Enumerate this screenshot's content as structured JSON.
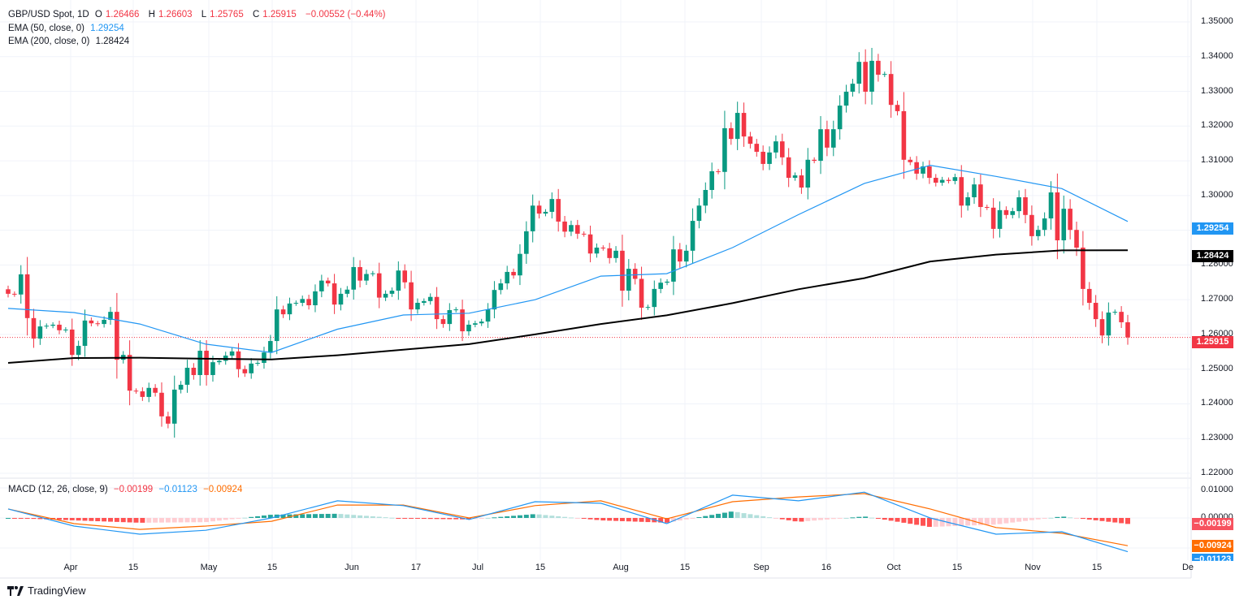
{
  "header": {
    "symbol": "GBP/USD Spot, 1D",
    "o_label": "O",
    "open": "1.26466",
    "h_label": "H",
    "high": "1.26603",
    "l_label": "L",
    "low": "1.25765",
    "c_label": "C",
    "close": "1.25915",
    "change": "−0.00552 (−0.44%)",
    "ema50_label": "EMA (50, close, 0)",
    "ema50_value": "1.29254",
    "ema200_label": "EMA (200, close, 0)",
    "ema200_value": "1.28424"
  },
  "macd_legend": {
    "label": "MACD (12, 26, close, 9)",
    "hist": "−0.00199",
    "macd": "−0.01123",
    "signal": "−0.00924"
  },
  "price_axis": [
    "1.35000",
    "1.34000",
    "1.33000",
    "1.32000",
    "1.31000",
    "1.30000",
    "1.29000",
    "1.28000",
    "1.27000",
    "1.26000",
    "1.25000",
    "1.24000",
    "1.23000",
    "1.22000"
  ],
  "macd_axis": [
    "0.01000",
    "0.00000"
  ],
  "badges": {
    "ema50": "1.29254",
    "ema200": "1.28424",
    "last": "1.25915",
    "hist": "−0.00199",
    "signal": "−0.00924",
    "macd": "−0.01123"
  },
  "x_axis": [
    "Apr",
    "15",
    "May",
    "15",
    "Jun",
    "17",
    "Jul",
    "15",
    "Aug",
    "15",
    "Sep",
    "16",
    "Oct",
    "15",
    "Nov",
    "15",
    "De"
  ],
  "brand": "TradingView",
  "colors": {
    "up": "#089981",
    "down": "#f23645",
    "ema50": "#2196f3",
    "ema200": "#000000",
    "macd": "#2196f3",
    "signal": "#ff6d00"
  },
  "chart_data": [
    {
      "type": "candlestick",
      "title": "GBP/USD Spot, 1D",
      "ylim": [
        1.22,
        1.35
      ],
      "grid": true,
      "first_open": 1.273,
      "closes": [
        1.2717,
        1.2715,
        1.2773,
        1.2647,
        1.2588,
        1.2623,
        1.2625,
        1.2628,
        1.2612,
        1.2614,
        1.2541,
        1.2567,
        1.264,
        1.2632,
        1.263,
        1.2642,
        1.2665,
        1.2527,
        1.2541,
        1.2438,
        1.2436,
        1.242,
        1.2446,
        1.2432,
        1.2364,
        1.2343,
        1.2441,
        1.2455,
        1.2504,
        1.2483,
        1.2553,
        1.2483,
        1.252,
        1.2524,
        1.2539,
        1.2551,
        1.25,
        1.2488,
        1.2516,
        1.2518,
        1.2548,
        1.2581,
        1.2672,
        1.2658,
        1.2689,
        1.2691,
        1.2702,
        1.2684,
        1.2724,
        1.2755,
        1.2747,
        1.2686,
        1.2717,
        1.2729,
        1.2794,
        1.2755,
        1.2774,
        1.2776,
        1.2706,
        1.2717,
        1.2726,
        1.2784,
        1.275,
        1.2672,
        1.2691,
        1.2696,
        1.2708,
        1.2644,
        1.263,
        1.267,
        1.2672,
        1.2609,
        1.2628,
        1.2632,
        1.2637,
        1.2672,
        1.2728,
        1.2747,
        1.278,
        1.277,
        1.2832,
        1.2897,
        1.2971,
        1.2948,
        1.2953,
        1.299,
        1.2925,
        1.2896,
        1.2915,
        1.289,
        1.2888,
        1.2833,
        1.285,
        1.2848,
        1.282,
        1.2841,
        1.2726,
        1.2789,
        1.276,
        1.2677,
        1.2679,
        1.2731,
        1.2749,
        1.2752,
        1.2845,
        1.281,
        1.2841,
        1.2927,
        1.2971,
        1.3016,
        1.307,
        1.3068,
        1.3194,
        1.3163,
        1.3238,
        1.317,
        1.3149,
        1.3126,
        1.3091,
        1.3124,
        1.3156,
        1.311,
        1.3051,
        1.3058,
        1.3023,
        1.3103,
        1.31,
        1.3191,
        1.3138,
        1.3191,
        1.3259,
        1.3299,
        1.3322,
        1.3385,
        1.3299,
        1.3388,
        1.3348,
        1.335,
        1.3261,
        1.3243,
        1.3103,
        1.3096,
        1.3063,
        1.3084,
        1.3051,
        1.3037,
        1.3045,
        1.3042,
        1.3053,
        1.2971,
        1.2995,
        1.3032,
        1.2967,
        1.2965,
        1.2904,
        1.2958,
        1.2944,
        1.2955,
        1.2995,
        1.2944,
        1.2883,
        1.2901,
        1.2934,
        1.3009,
        1.2871,
        1.2962,
        1.2901,
        1.285,
        1.2731,
        1.2691,
        1.2644,
        1.2597,
        1.2663,
        1.2665,
        1.2635,
        1.25915
      ],
      "series": [
        {
          "name": "EMA (50, close, 0)",
          "values": [
            1.2675,
            1.2663,
            1.263,
            1.2572,
            1.2548,
            1.2615,
            1.2656,
            1.2661,
            1.27,
            1.2768,
            1.2775,
            1.285,
            1.2945,
            1.3035,
            1.3087,
            1.3055,
            1.302,
            1.29254
          ]
        },
        {
          "name": "EMA (200, close, 0)",
          "values": [
            1.2518,
            1.2532,
            1.2533,
            1.253,
            1.2528,
            1.254,
            1.2556,
            1.2572,
            1.26,
            1.263,
            1.2655,
            1.269,
            1.273,
            1.2762,
            1.281,
            1.283,
            1.2842,
            1.28424
          ]
        }
      ],
      "current_price": 1.25915
    },
    {
      "type": "line",
      "title": "MACD (12, 26, close, 9)",
      "ylim": [
        -0.0125,
        0.013
      ],
      "series": [
        {
          "name": "MACD",
          "values": [
            0.003,
            -0.0027,
            -0.0054,
            -0.0041,
            0.0,
            0.0057,
            0.0041,
            -0.0005,
            0.0054,
            0.0049,
            -0.0019,
            0.0076,
            0.0057,
            0.0086,
            0.0,
            -0.0054,
            -0.0046,
            -0.01123
          ]
        },
        {
          "name": "Signal",
          "values": [
            0.003,
            -0.0019,
            -0.0038,
            -0.0027,
            -0.0011,
            0.0043,
            0.0043,
            0.0,
            0.0041,
            0.0057,
            -0.0003,
            0.0054,
            0.007,
            0.0081,
            0.003,
            -0.0032,
            -0.0051,
            -0.00924
          ]
        }
      ],
      "histogram_last": -0.00199
    }
  ]
}
